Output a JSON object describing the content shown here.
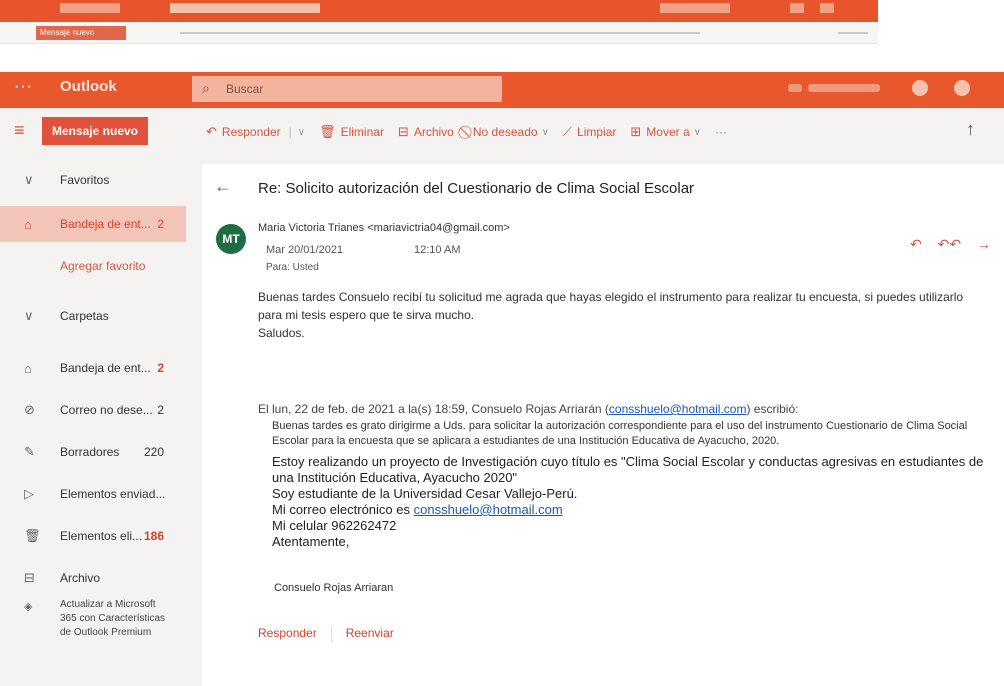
{
  "ghost": {
    "new_message": "Mensaje nuevo"
  },
  "topbar": {
    "brand": "Outlook",
    "search_placeholder": "Buscar"
  },
  "commands": {
    "new_message": "Mensaje nuevo",
    "reply": "Responder",
    "delete": "Eliminar",
    "archive": "Archivo",
    "junk": "No deseado",
    "sweep": "Limpiar",
    "move_to": "Mover a",
    "more": "···"
  },
  "sidebar": {
    "favorites": "Favoritos",
    "inbox_fav": {
      "label": "Bandeja de ent...",
      "count": "2"
    },
    "add_favorite": "Agregar favorito",
    "folders": "Carpetas",
    "items": [
      {
        "label": "Bandeja de ent...",
        "count": "2"
      },
      {
        "label": "Correo no dese...",
        "count": "2"
      },
      {
        "label": "Borradores",
        "count": "220"
      },
      {
        "label": "Elementos enviad...",
        "count": ""
      },
      {
        "label": "Elementos eli...",
        "count": "186"
      },
      {
        "label": "Archivo",
        "count": ""
      }
    ],
    "upgrade": "Actualizar a Microsoft 365 con Características de Outlook Premium"
  },
  "message": {
    "subject": "Re: Solicito autorización del Cuestionario de Clima Social Escolar",
    "avatar_initials": "MT",
    "avatar_color": "#1f6e43",
    "from": "Maria Victoria Trianes <mariavictria04@gmail.com>",
    "date": "Mar 20/01/2021",
    "time": "12:10 AM",
    "to": "Para: Usted",
    "body_line1": "Buenas tardes Consuelo recibí tu solicitud me agrada que hayas elegido el instrumento para realizar tu encuesta, si puedes utilizarlo para mi tesis espero que te sirva mucho.",
    "body_line2": "Saludos.",
    "quote_head_pre": "El lun, 22 de feb. de 2021 a la(s) 18:59, Consuelo Rojas Arriarán (",
    "quote_head_link": "consshuelo@hotmail.com",
    "quote_head_post": ") escribió:",
    "quote_line1": "Buenas tardes es grato dirigirme a Uds. para solicitar la autorización correspondiente para el uso del instrumento Cuestionario de Clima Social Escolar  para la encuesta que se aplicara a estudiantes de una Institución Educativa de Ayacucho, 2020.",
    "quote_line2": "Estoy realizando un proyecto de Investigación cuyo título es \"Clima Social Escolar y conductas agresivas en estudiantes de una Institución Educativa, Ayacucho 2020\"",
    "quote_line3": "Soy estudiante de la Universidad Cesar Vallejo-Perú.",
    "quote_line4_pre": "Mi correo electrónico es ",
    "quote_line4_link": "consshuelo@hotmail.com",
    "quote_line5": "Mi celular 962262472",
    "quote_line6": "Atentamente,",
    "signature": "Consuelo Rojas Arriaran",
    "reply": "Responder",
    "forward": "Reenviar"
  }
}
